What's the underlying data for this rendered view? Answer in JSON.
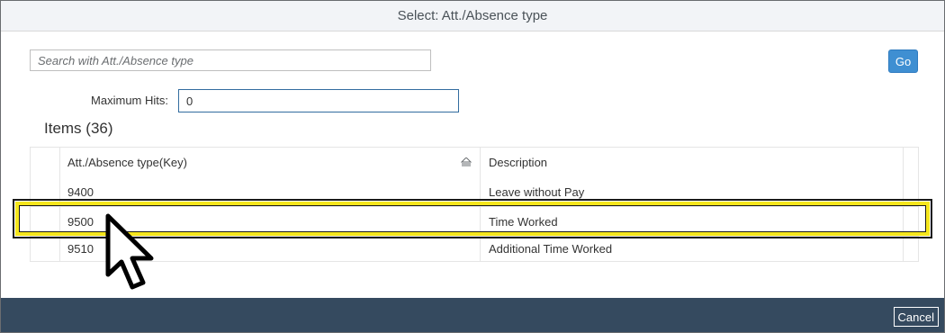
{
  "dialog": {
    "title": "Select: Att./Absence type"
  },
  "search": {
    "placeholder": "Search with Att./Absence type",
    "value": "",
    "go_label": "Go"
  },
  "max_hits": {
    "label": "Maximum Hits:",
    "value": "0"
  },
  "items": {
    "title": "Items (36)",
    "columns": [
      "Att./Absence type(Key)",
      "Description"
    ],
    "rows": [
      {
        "key": "9400",
        "description": "Leave without Pay"
      },
      {
        "key": "9500",
        "description": "Time Worked"
      },
      {
        "key": "9510",
        "description": "Additional Time Worked"
      }
    ]
  },
  "footer": {
    "cancel_label": "Cancel"
  },
  "colors": {
    "header_bg": "#f2f4f7",
    "footer_bg": "#354a5f",
    "go_button": "#3f8fd2",
    "highlight": "#f5e61c"
  }
}
